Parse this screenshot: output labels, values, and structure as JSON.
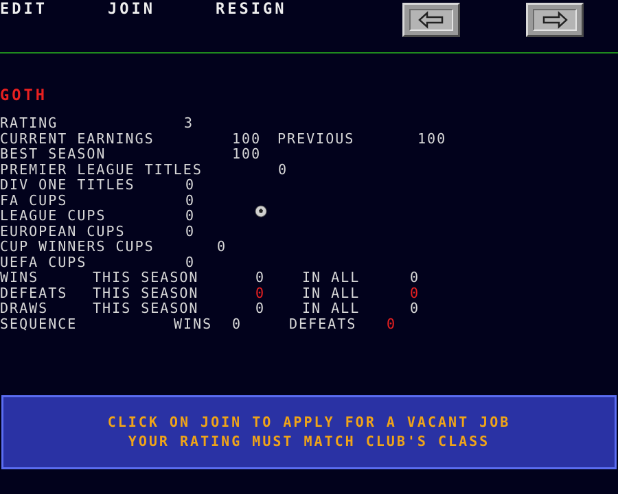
{
  "menu": {
    "edit": "EDIT",
    "join": "JOIN",
    "resign": "RESIGN"
  },
  "nav": {
    "prev_icon": "left-arrow-icon",
    "next_icon": "right-arrow-icon"
  },
  "club": {
    "name": "GOTH",
    "rating_label": "RATING",
    "rating": "3",
    "current_earnings_label": "CURRENT EARNINGS",
    "current_earnings": "100",
    "previous_label": "PREVIOUS",
    "previous": "100",
    "best_season_label": "BEST SEASON",
    "best_season": "100",
    "premier_titles_label": "PREMIER LEAGUE TITLES",
    "premier_titles": "0",
    "div_one_titles_label": "DIV ONE TITLES",
    "div_one_titles": "0",
    "fa_cups_label": "FA CUPS",
    "fa_cups": "0",
    "league_cups_label": "LEAGUE CUPS",
    "league_cups": "0",
    "european_cups_label": "EUROPEAN CUPS",
    "european_cups": "0",
    "cup_winners_cups_label": "CUP WINNERS CUPS",
    "cup_winners_cups": "0",
    "uefa_cups_label": "UEFA CUPS",
    "uefa_cups": "0"
  },
  "record": {
    "this_season_label": "THIS SEASON",
    "in_all_label": "IN ALL",
    "wins_label": "WINS",
    "wins_season": "0",
    "wins_all": "0",
    "defeats_label": "DEFEATS",
    "defeats_season": "0",
    "defeats_all": "0",
    "draws_label": "DRAWS",
    "draws_season": "0",
    "draws_all": "0",
    "sequence_label": "SEQUENCE",
    "seq_wins_label": "WINS",
    "seq_wins": "0",
    "seq_defeats_label": "DEFEATS",
    "seq_defeats": "0"
  },
  "info": {
    "line1": "CLICK ON JOIN TO APPLY FOR A VACANT JOB",
    "line2": "YOUR RATING MUST MATCH CLUB'S CLASS"
  },
  "colors": {
    "background": "#02021c",
    "highlight_red": "#e82020",
    "info_text": "#f0a418",
    "panel": "#2a32a4"
  }
}
